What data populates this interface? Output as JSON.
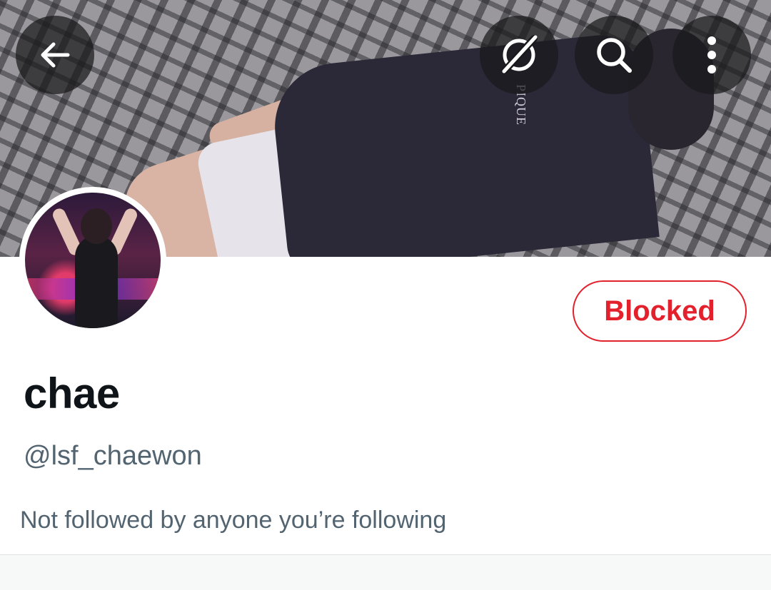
{
  "header": {
    "back_icon": "arrow-left-icon",
    "grok_icon": "grok-icon",
    "search_icon": "search-icon",
    "more_icon": "more-vertical-icon",
    "overlay_color": "#19191c"
  },
  "banner": {
    "shirt_text": "PIQUE"
  },
  "profile": {
    "display_name": "chae",
    "handle": "@lsf_chaewon",
    "followed_by_text": "Not followed by anyone you’re following",
    "block_button_label": "Blocked",
    "accent_color": "#e3212d",
    "name_color": "#0f1419",
    "secondary_text_color": "#536471"
  }
}
